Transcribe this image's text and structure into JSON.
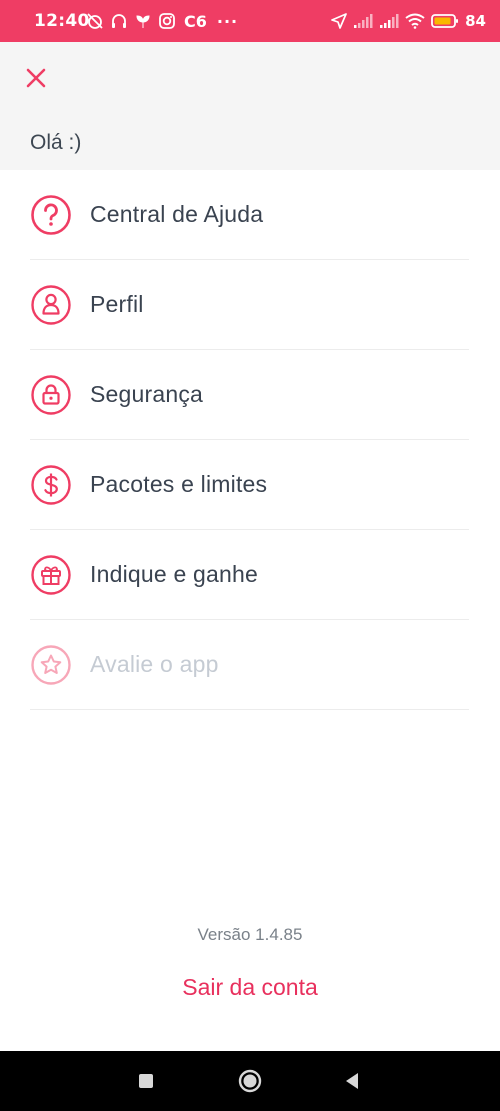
{
  "status_bar": {
    "time": "12:40",
    "carrier": "C6",
    "more": "···",
    "battery": "84",
    "left_icons": [
      "alarm-off-icon",
      "headphones-icon",
      "plant-icon",
      "instagram-icon"
    ],
    "right_icons": [
      "location-arrow-icon",
      "signal-icon",
      "signal-icon",
      "wifi-icon",
      "battery-icon"
    ]
  },
  "header": {
    "close_icon": "close-icon",
    "greeting": "Olá :)"
  },
  "colors": {
    "accent": "#ef3d64",
    "text": "#3a4350",
    "disabled": "#c5cbd3",
    "header_bg": "#f5f5f5"
  },
  "menu": {
    "items": [
      {
        "label": "Central de Ajuda",
        "icon": "help-circle-icon",
        "enabled": true
      },
      {
        "label": "Perfil",
        "icon": "profile-icon",
        "enabled": true
      },
      {
        "label": "Segurança",
        "icon": "lock-icon",
        "enabled": true
      },
      {
        "label": "Pacotes e limites",
        "icon": "dollar-icon",
        "enabled": true
      },
      {
        "label": "Indique e ganhe",
        "icon": "gift-icon",
        "enabled": true
      },
      {
        "label": "Avalie o app",
        "icon": "star-icon",
        "enabled": false
      }
    ]
  },
  "footer": {
    "version": "Versão 1.4.85",
    "logout": "Sair da conta"
  },
  "nav_bar": {
    "buttons": [
      "recent-apps-icon",
      "home-icon",
      "back-icon"
    ]
  }
}
